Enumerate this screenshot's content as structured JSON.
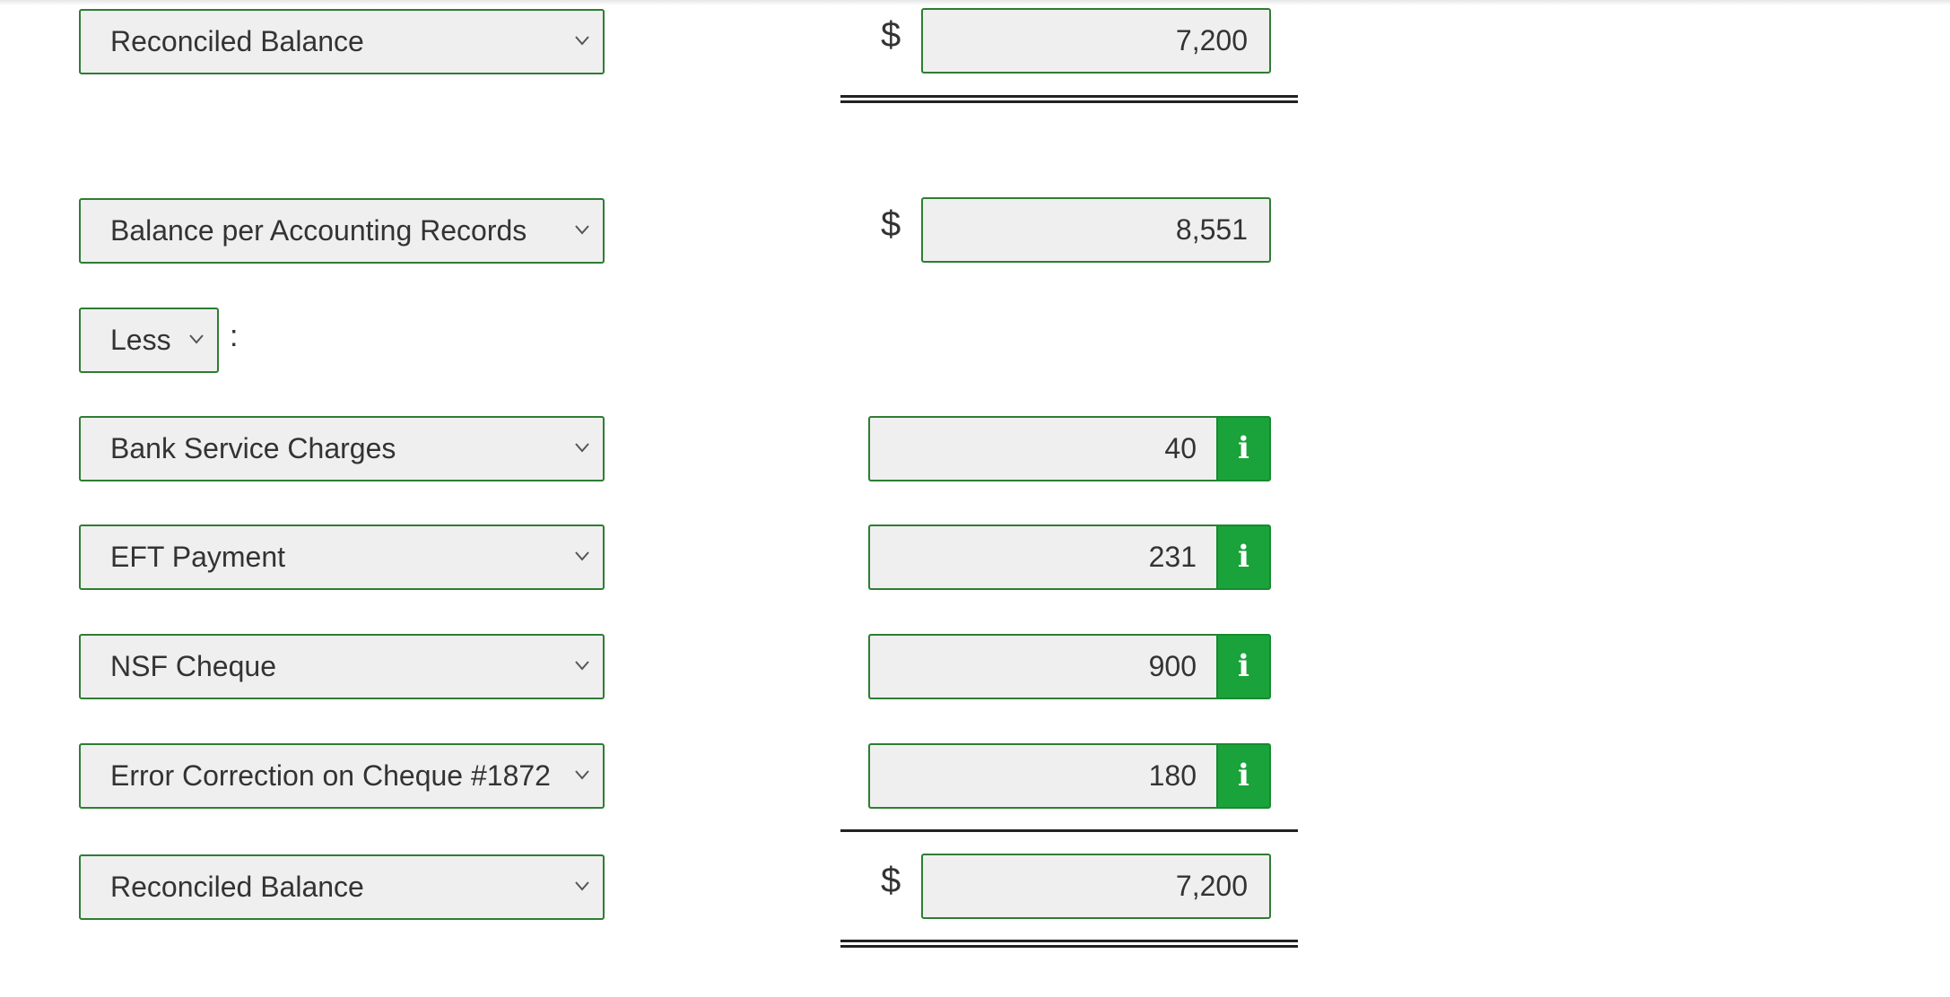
{
  "bank_side": {
    "reconciled_label": "Reconciled Balance",
    "currency": "$",
    "reconciled_amount": "7,200"
  },
  "book_side": {
    "balance_label": "Balance per Accounting Records",
    "currency": "$",
    "balance_amount": "8,551",
    "operator_label": "Less",
    "colon": ":",
    "items": [
      {
        "label": "Bank Service Charges",
        "amount": "40"
      },
      {
        "label": "EFT Payment",
        "amount": "231"
      },
      {
        "label": "NSF Cheque",
        "amount": "900"
      },
      {
        "label": "Error Correction on Cheque #1872",
        "amount": "180"
      }
    ],
    "reconciled_label": "Reconciled Balance",
    "reconciled_amount": "7,200"
  },
  "info_glyph": "i",
  "icons": {
    "dropdown": "chevron-down-icon",
    "info": "info-icon"
  },
  "colors": {
    "border": "#2e7d32",
    "field_bg": "#efefef",
    "info_bg": "#1aa33a"
  }
}
